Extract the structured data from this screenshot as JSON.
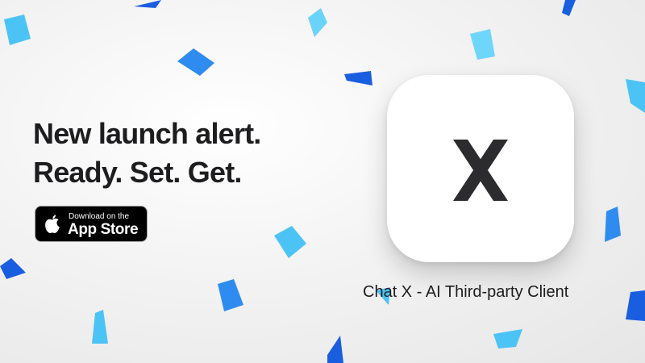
{
  "headline": {
    "line1": "New launch alert.",
    "line2": "Ready. Set. Get."
  },
  "badge": {
    "small_text": "Download on the",
    "big_text": "App Store",
    "icon": "apple-icon"
  },
  "app": {
    "icon": "x-icon",
    "name": "Chat X - AI Third-party Client"
  },
  "colors": {
    "confetti_blue": "#1a5ee0",
    "confetti_light_blue": "#2e8cf0",
    "confetti_cyan": "#5ad2f8",
    "x_mark": "#2c2c2e",
    "badge_background": "#000000"
  }
}
